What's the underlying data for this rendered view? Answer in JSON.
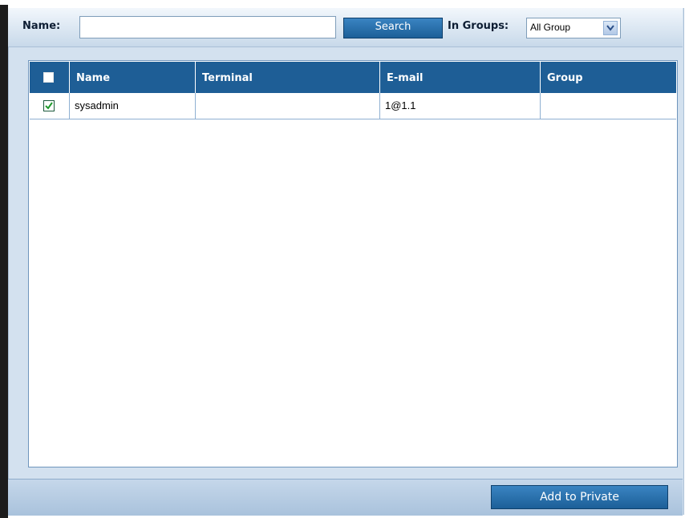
{
  "search": {
    "name_label": "Name:",
    "name_value": "",
    "search_button": "Search",
    "groups_label": "In Groups:",
    "groups_selected": "All Group"
  },
  "table": {
    "columns": [
      "Name",
      "Terminal",
      "E-mail",
      "Group"
    ],
    "rows": [
      {
        "checked": true,
        "name": "sysadmin",
        "terminal": "",
        "email": "1@1.1",
        "group": ""
      }
    ]
  },
  "footer": {
    "add_button": "Add to Private"
  },
  "colors": {
    "header_bg": "#1e5e96",
    "button_bg": "#1c5f98",
    "panel_bg": "#d3e1ef"
  }
}
